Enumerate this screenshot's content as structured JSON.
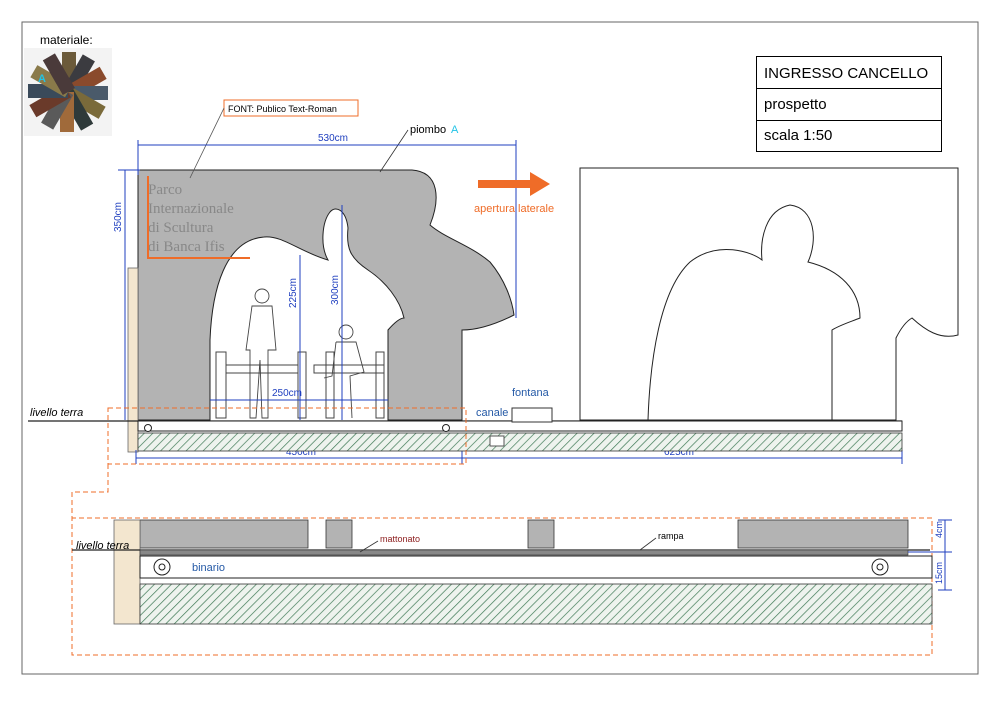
{
  "title_block": {
    "name": "INGRESSO CANCELLO",
    "view": "prospetto",
    "scale": "scala 1:50"
  },
  "material": {
    "label": "materiale:",
    "swatch_tag": "A"
  },
  "callouts": {
    "font_note": "FONT: Publico Text-Roman",
    "piombo": "piombo",
    "piombo_tag": "A",
    "apertura": "apertura laterale",
    "fontana": "fontana",
    "canale": "canale",
    "mattonato": "mattonato",
    "rampa": "rampa",
    "binario": "binario"
  },
  "ground_labels": {
    "elevation": "livello terra",
    "section": "livello terra"
  },
  "sign_text": [
    "Parco",
    "Internazionale",
    "di Scultura",
    "di Banca Ifis"
  ],
  "dimensions": {
    "width_total": "530cm",
    "height_total": "350cm",
    "opening_width": "250cm",
    "opening_height": "225cm",
    "figure_height": "300cm",
    "fixed_part": "450cm",
    "sliding_part": "625cm",
    "layer_top": "4cm",
    "layer_bottom": "15cm"
  },
  "colors": {
    "gate_fill": "#b3b3b3",
    "accent_orange": "#ef6c28",
    "dimension_blue": "#1f3fbf",
    "label_blue": "#2459a6",
    "hatch_green": "#3f7a56",
    "cyan_tag": "#22c3e6"
  }
}
